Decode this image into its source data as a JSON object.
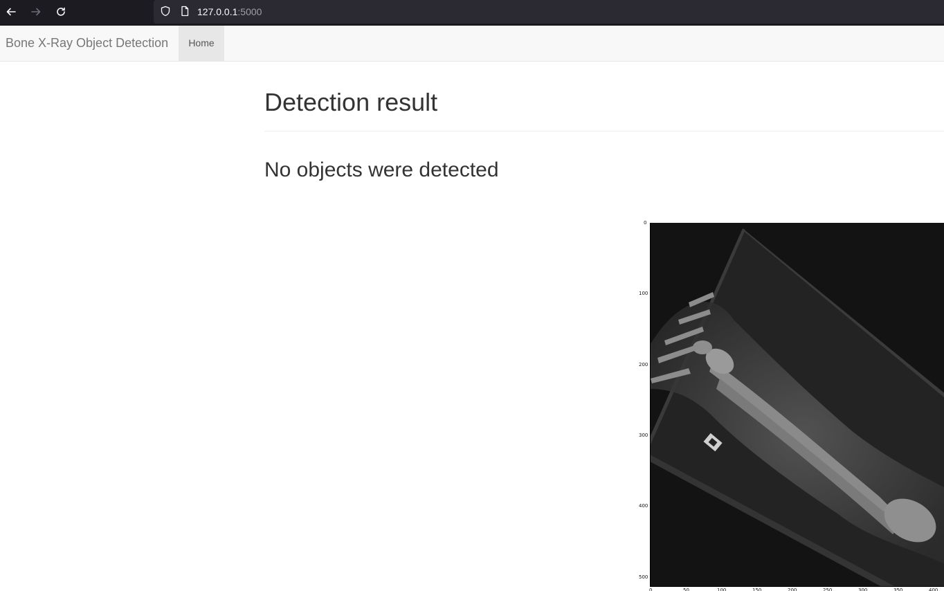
{
  "browser": {
    "url_host": "127.0.0.1",
    "url_port": ":5000",
    "icons": [
      "back-arrow-icon",
      "forward-arrow-icon",
      "reload-icon",
      "shield-icon",
      "page-icon"
    ]
  },
  "navbar": {
    "brand": "Bone X-Ray Object Detection",
    "home_label": "Home"
  },
  "main": {
    "title": "Detection result",
    "message": "No objects were detected"
  },
  "figure": {
    "y_ticks": [
      "0",
      "100",
      "200",
      "300",
      "400",
      "500"
    ],
    "x_ticks": [
      "0",
      "50",
      "100",
      "150",
      "200",
      "250",
      "300",
      "350",
      "400"
    ]
  },
  "colors": {
    "browser_bg": "#1c1b22",
    "urlbar_bg": "#2b2a33",
    "navbar_bg": "#f8f8f8",
    "active_nav_bg": "#e7e7e7",
    "heading_text": "#333333"
  }
}
